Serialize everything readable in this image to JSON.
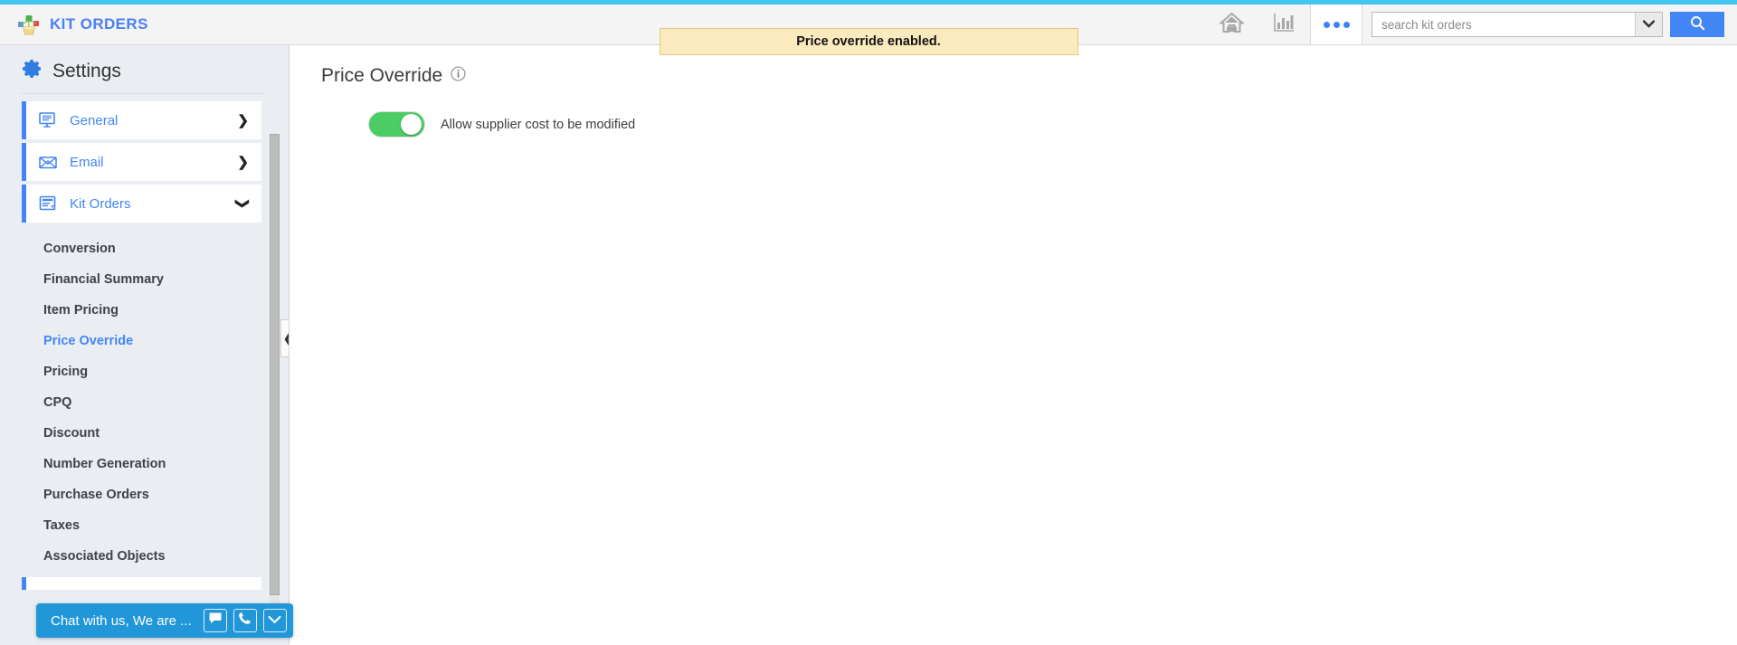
{
  "theme": {
    "accent_top": "#45c6f2",
    "brand_blue": "#4a80f5",
    "link_blue": "#4285f4",
    "toggle_on_green": "#4ccc65",
    "banner_bg": "#faeabd",
    "banner_border": "#e3c97f",
    "chat_blue": "#2196d8",
    "sidebar_bg": "#eaeef3"
  },
  "header": {
    "brand_name": "KIT ORDERS",
    "logo_icon": "kit-orders-cubes-box-logo",
    "home_icon": "home-icon",
    "reports_icon": "bar-chart-icon",
    "more_icon": "more-dots-icon",
    "search": {
      "placeholder": "search kit orders",
      "value": "",
      "caret_icon": "chevron-down-icon",
      "button_icon": "search-icon"
    }
  },
  "banner": {
    "message": "Price override enabled."
  },
  "sidebar": {
    "title": "Settings",
    "gear_icon": "gear-icon",
    "groups": [
      {
        "label": "General",
        "icon": "monitor-icon",
        "chevron": "❯",
        "expanded": false
      },
      {
        "label": "Email",
        "icon": "envelope-icon",
        "chevron": "❯",
        "expanded": false
      },
      {
        "label": "Kit Orders",
        "icon": "document-list-icon",
        "chevron": "❯",
        "expanded": true
      }
    ],
    "kit_orders_items": [
      {
        "label": "Conversion",
        "active": false
      },
      {
        "label": "Financial Summary",
        "active": false
      },
      {
        "label": "Item Pricing",
        "active": false
      },
      {
        "label": "Price Override",
        "active": true
      },
      {
        "label": "Pricing",
        "active": false
      },
      {
        "label": "CPQ",
        "active": false
      },
      {
        "label": "Discount",
        "active": false
      },
      {
        "label": "Number Generation",
        "active": false
      },
      {
        "label": "Purchase Orders",
        "active": false
      },
      {
        "label": "Taxes",
        "active": false
      },
      {
        "label": "Associated Objects",
        "active": false
      }
    ],
    "collapse_chevron": "❮"
  },
  "main": {
    "page_title": "Price Override",
    "info_icon": "info-icon",
    "toggle": {
      "label": "Allow supplier cost to be modified",
      "state": "on"
    }
  },
  "chat": {
    "text": "Chat with us, We are ...",
    "message_icon": "chat-bubble-icon",
    "call_icon": "phone-icon",
    "collapse_icon": "chevron-down-icon"
  }
}
